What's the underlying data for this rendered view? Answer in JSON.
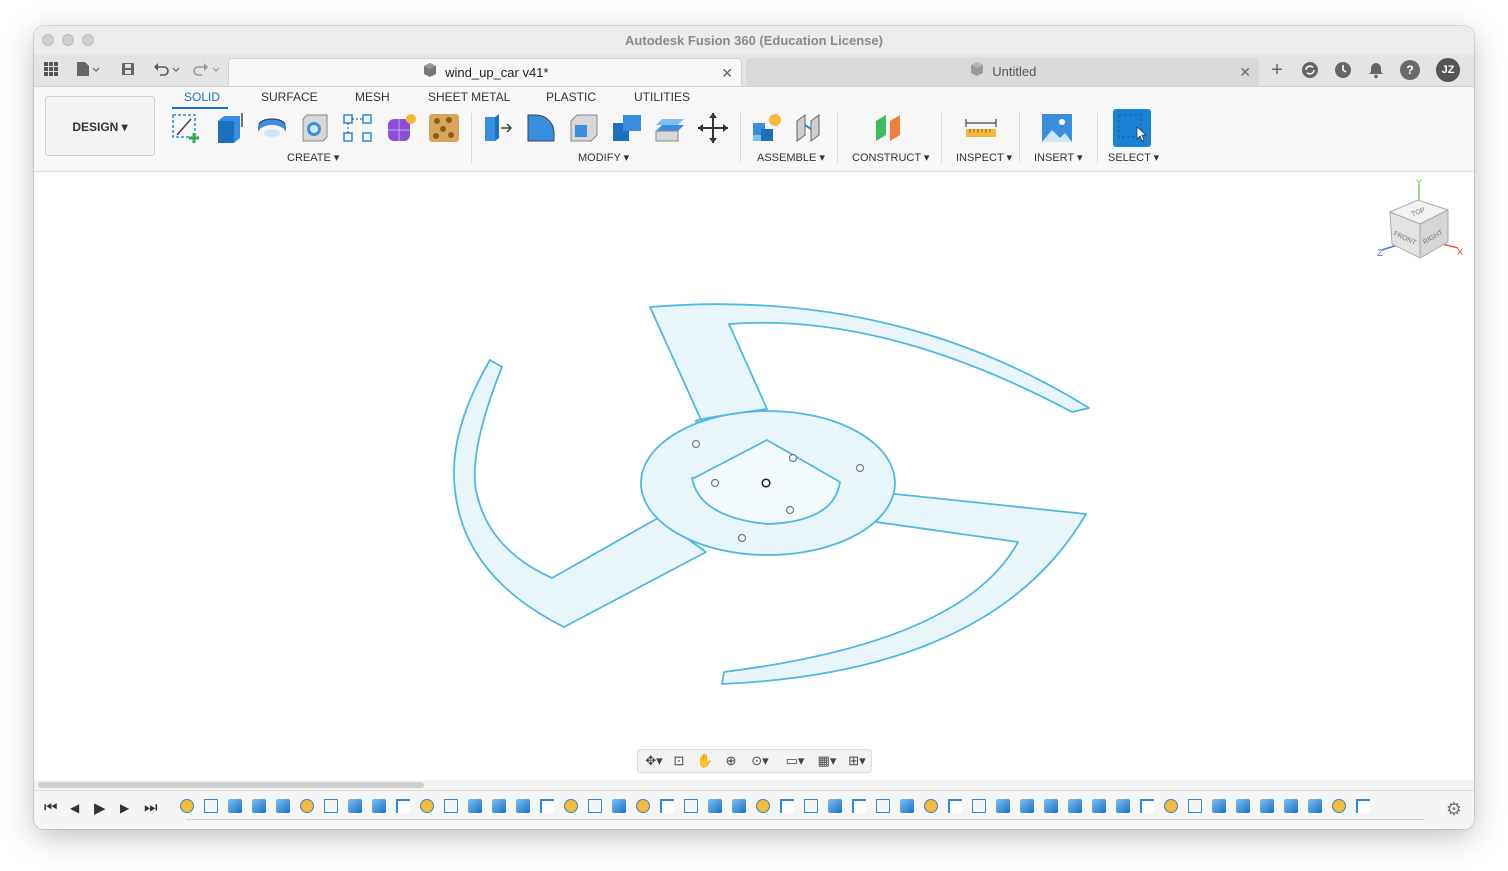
{
  "window": {
    "title": "Autodesk Fusion 360 (Education License)"
  },
  "tabs": {
    "active": {
      "label": "wind_up_car v41*",
      "close": "✕"
    },
    "inactive": {
      "label": "Untitled",
      "close": "✕"
    },
    "new_tab": "+",
    "user_initials": "JZ",
    "help": "?"
  },
  "ribbon": {
    "workspace": "DESIGN ▾",
    "tabs": [
      "SOLID",
      "SURFACE",
      "MESH",
      "SHEET METAL",
      "PLASTIC",
      "UTILITIES"
    ],
    "groups": {
      "create": "CREATE ▾",
      "modify": "MODIFY ▾",
      "assemble": "ASSEMBLE ▾",
      "construct": "CONSTRUCT ▾",
      "inspect": "INSPECT ▾",
      "insert": "INSERT ▾",
      "select": "SELECT ▾"
    }
  },
  "viewcube": {
    "top": "TOP",
    "front": "FRONT",
    "right": "RIGHT",
    "x": "X",
    "y": "Y",
    "z": "Z"
  },
  "colors": {
    "accent": "#1b6fc2",
    "sketch_stroke": "#4fb8e0",
    "sketch_fill": "#e8f6fc",
    "select_tool": "#1a82d6"
  },
  "timeline": {
    "controls": [
      "⏮",
      "◀",
      "▶",
      "▶",
      "⏭"
    ]
  }
}
